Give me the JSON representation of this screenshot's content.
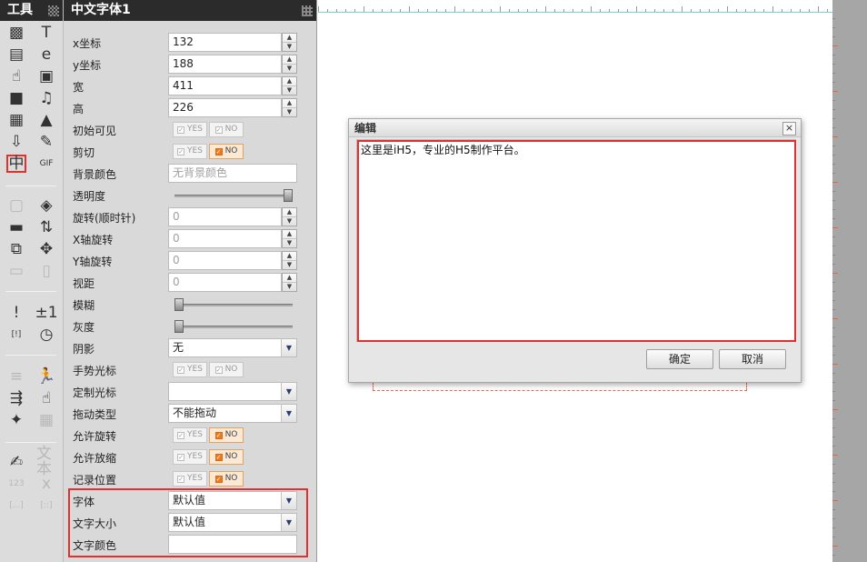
{
  "toolbar": {
    "title": "工具",
    "tools": [
      {
        "name": "image-icon",
        "glyph": "▩",
        "dim": false
      },
      {
        "name": "text-icon",
        "glyph": "T",
        "dim": false
      },
      {
        "name": "document-icon",
        "glyph": "▤",
        "dim": false
      },
      {
        "name": "edit-text-icon",
        "glyph": "e",
        "dim": false
      },
      {
        "name": "touch-icon",
        "glyph": "☝",
        "dim": false
      },
      {
        "name": "picture-icon",
        "glyph": "▣",
        "dim": false
      },
      {
        "name": "video-icon",
        "glyph": "■",
        "dim": false
      },
      {
        "name": "music-icon",
        "glyph": "♫",
        "dim": false
      },
      {
        "name": "qrcode-icon",
        "glyph": "▦",
        "dim": false
      },
      {
        "name": "stamp-icon",
        "glyph": "▲",
        "dim": false
      },
      {
        "name": "download-icon",
        "glyph": "⇩",
        "dim": false
      },
      {
        "name": "brush-icon",
        "glyph": "✎",
        "dim": false
      },
      {
        "name": "chinese-font-icon",
        "glyph": "中",
        "dim": false
      },
      {
        "name": "gif-icon",
        "glyph": "GIF",
        "dim": false
      },
      {
        "name": "blank-page-icon",
        "glyph": "▢",
        "dim": true
      },
      {
        "name": "layers-icon",
        "glyph": "◈",
        "dim": false
      },
      {
        "name": "folder-icon",
        "glyph": "▬",
        "dim": false
      },
      {
        "name": "sort-icon",
        "glyph": "⇅",
        "dim": false
      },
      {
        "name": "copy-icon",
        "glyph": "⧉",
        "dim": false
      },
      {
        "name": "move-icon",
        "glyph": "✥",
        "dim": false
      },
      {
        "name": "monitor-icon",
        "glyph": "▭",
        "dim": true
      },
      {
        "name": "tablet-icon",
        "glyph": "▯",
        "dim": true
      },
      {
        "name": "alert-icon",
        "glyph": "!",
        "dim": false
      },
      {
        "name": "plus-minus-icon",
        "glyph": "±1",
        "dim": false
      },
      {
        "name": "bracket-icon",
        "glyph": "[!]",
        "dim": false
      },
      {
        "name": "timer-icon",
        "glyph": "◷",
        "dim": false
      },
      {
        "name": "sliders-icon",
        "glyph": "≡",
        "dim": true
      },
      {
        "name": "runner-icon",
        "glyph": "🏃",
        "dim": false
      },
      {
        "name": "shuffle-icon",
        "glyph": "⇶",
        "dim": false
      },
      {
        "name": "hand-pointer-icon",
        "glyph": "☝",
        "dim": false
      },
      {
        "name": "magic-wand-icon",
        "glyph": "✦",
        "dim": false
      },
      {
        "name": "table-icon",
        "glyph": "▦",
        "dim": true
      },
      {
        "name": "note-edit-icon",
        "glyph": "✍",
        "dim": false
      },
      {
        "name": "textbox-icon",
        "glyph": "文本",
        "dim": true
      },
      {
        "name": "number-icon",
        "glyph": "123",
        "dim": true
      },
      {
        "name": "variable-x-icon",
        "glyph": "x",
        "dim": true
      },
      {
        "name": "ellipsis-bracket-icon",
        "glyph": "[...]",
        "dim": true
      },
      {
        "name": "dots-bracket-icon",
        "glyph": "[::]",
        "dim": true
      }
    ]
  },
  "props": {
    "title": "中文字体1",
    "rows": [
      {
        "label": "x坐标",
        "type": "number",
        "value": "132"
      },
      {
        "label": "y坐标",
        "type": "number",
        "value": "188"
      },
      {
        "label": "宽",
        "type": "number",
        "value": "411"
      },
      {
        "label": "高",
        "type": "number",
        "value": "226"
      },
      {
        "label": "初始可见",
        "type": "toggle",
        "on": "none"
      },
      {
        "label": "剪切",
        "type": "toggle",
        "on": "no"
      },
      {
        "label": "背景颜色",
        "type": "color",
        "value": "无背景颜色",
        "placeholder": true
      },
      {
        "label": "透明度",
        "type": "slider",
        "level": 1.0
      },
      {
        "label": "旋转(顺时针)",
        "type": "number",
        "value": "0",
        "dimval": true
      },
      {
        "label": "X轴旋转",
        "type": "number",
        "value": "0",
        "dimval": true
      },
      {
        "label": "Y轴旋转",
        "type": "number",
        "value": "0",
        "dimval": true
      },
      {
        "label": "视距",
        "type": "number",
        "value": "0",
        "dimval": true
      },
      {
        "label": "模糊",
        "type": "slider",
        "level": 0.0
      },
      {
        "label": "灰度",
        "type": "slider",
        "level": 0.0
      },
      {
        "label": "阴影",
        "type": "select",
        "value": "无"
      },
      {
        "label": "手势光标",
        "type": "toggle",
        "on": "none"
      },
      {
        "label": "定制光标",
        "type": "select",
        "value": ""
      },
      {
        "label": "拖动类型",
        "type": "select",
        "value": "不能拖动"
      },
      {
        "label": "允许旋转",
        "type": "toggle",
        "on": "no"
      },
      {
        "label": "允许放缩",
        "type": "toggle",
        "on": "no"
      },
      {
        "label": "记录位置",
        "type": "toggle",
        "on": "no"
      },
      {
        "label": "字体",
        "type": "select",
        "value": "默认值"
      },
      {
        "label": "文字大小",
        "type": "select",
        "value": "默认值"
      },
      {
        "label": "文字颜色",
        "type": "color",
        "value": ""
      }
    ],
    "yes_label": "YES",
    "no_label": "NO"
  },
  "dialog": {
    "title": "编辑",
    "close_glyph": "×",
    "content": "这里是iH5，专业的H5制作平台。",
    "ok_label": "确定",
    "cancel_label": "取消"
  }
}
